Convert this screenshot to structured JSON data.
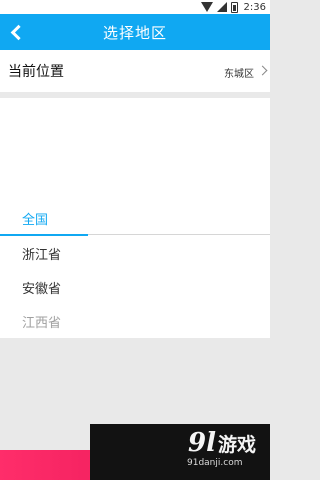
{
  "status_bar": {
    "time": "2:36"
  },
  "header": {
    "title": "选择地区"
  },
  "current_location": {
    "label": "当前位置",
    "value": "东城区"
  },
  "watermark": {
    "logo": "9l",
    "text": "游戏",
    "url": "91danji.com"
  },
  "province_list": {
    "items": [
      {
        "label": "全国",
        "state": "selected"
      },
      {
        "label": "浙江省",
        "state": "normal"
      },
      {
        "label": "安徽省",
        "state": "normal"
      },
      {
        "label": "江西省",
        "state": "faded"
      }
    ]
  },
  "colors": {
    "accent": "#10a8f2",
    "banner": "#ff2d6a",
    "background": "#e9e9e9"
  }
}
